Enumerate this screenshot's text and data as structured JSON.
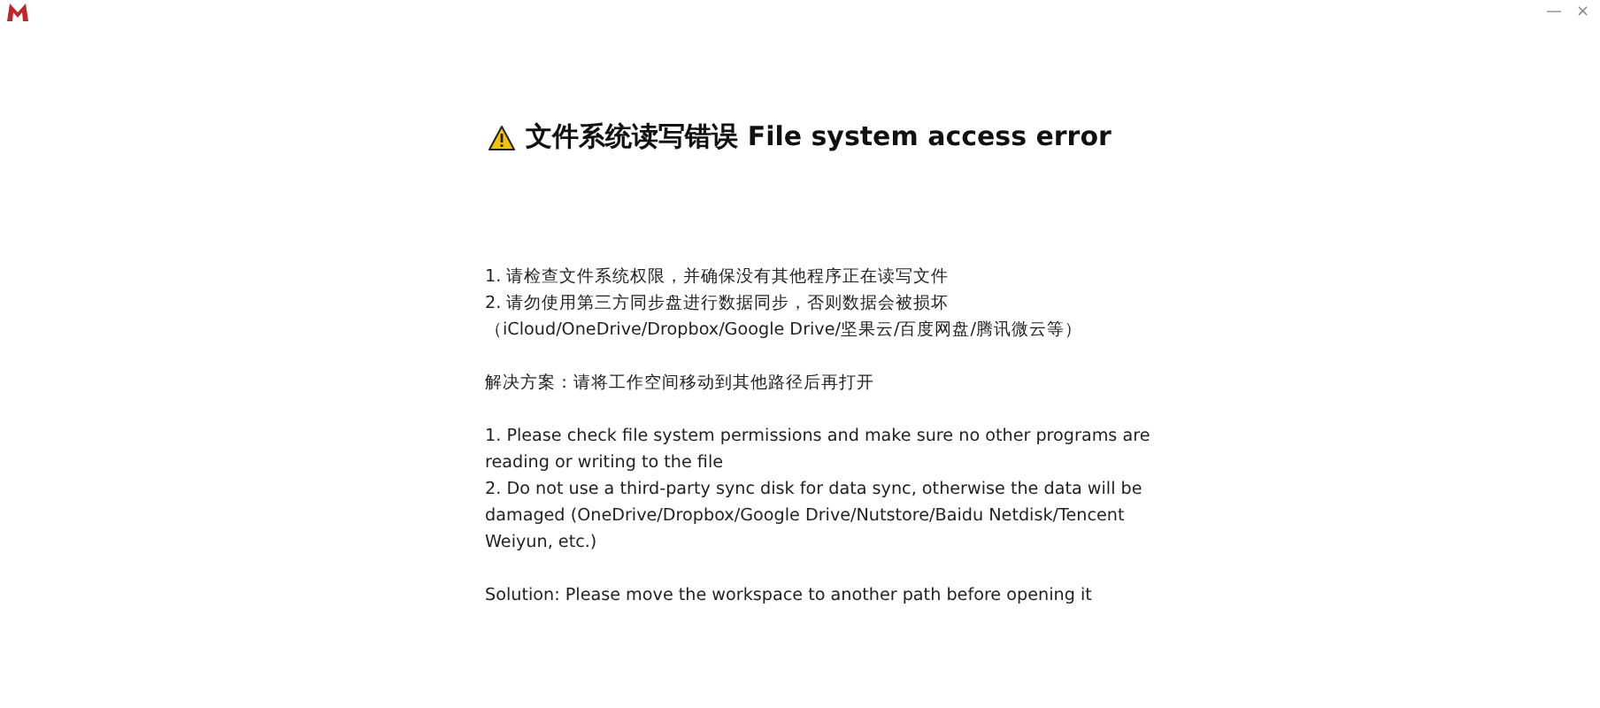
{
  "window": {
    "controls": [
      "—",
      "×"
    ]
  },
  "title": "文件系统读写错误 File system access error",
  "sections": [
    {
      "lines": [
        "1. 请检查文件系统权限，并确保没有其他程序正在读写文件",
        "2. 请勿使用第三方同步盘进行数据同步，否则数据会被损坏",
        "（iCloud/OneDrive/Dropbox/Google Drive/坚果云/百度网盘/腾讯微云等）"
      ]
    },
    {
      "lines": [
        "解决方案：请将工作空间移动到其他路径后再打开"
      ]
    },
    {
      "lines": [
        "1. Please check file system permissions and make sure no other programs are",
        "reading or writing to the file",
        "2. Do not use a third-party sync disk for data sync, otherwise the data will be",
        "damaged (OneDrive/Dropbox/Google Drive/Nutstore/Baidu Netdisk/Tencent",
        "Weiyun, etc.)"
      ]
    },
    {
      "lines": [
        "Solution: Please move the workspace to another path before opening it"
      ]
    }
  ]
}
